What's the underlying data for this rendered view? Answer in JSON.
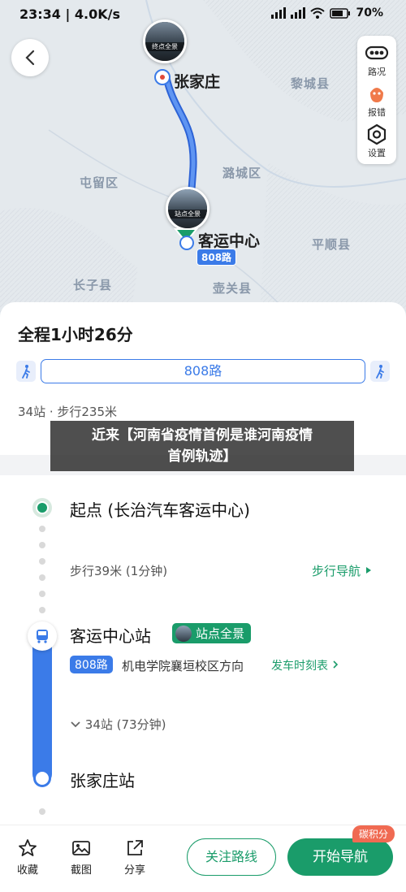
{
  "status": {
    "time": "23:34",
    "speed": "4.0K/s",
    "battery": "70"
  },
  "map": {
    "labels": {
      "shijiazhuang": "张家庄",
      "lichengxian": "黎城县",
      "tunliu": "屯留区",
      "lucheng": "潞城区",
      "keyun": "客运中心",
      "pingshun": "平顺县",
      "zhangzi": "长子县",
      "huguan": "壶关县"
    },
    "end_bubble_label": "终点全景",
    "start_bubble_label": "站点全景",
    "route_badge": "808路",
    "tools": {
      "traffic": "路况",
      "report": "报错",
      "settings": "设置"
    }
  },
  "summary": {
    "title": "全程1小时26分",
    "route_name": "808路",
    "meta": "34站 · 步行235米"
  },
  "caption": {
    "line1": "近来【河南省疫情首例是谁河南疫情",
    "line2": "首例轨迹】"
  },
  "steps": {
    "start": "起点 (长治汽车客运中心)",
    "walk": "步行39米 (1分钟)",
    "walk_nav": "步行导航",
    "station": "客运中心站",
    "station_view": "站点全景",
    "route": "808路",
    "direction": "机电学院襄垣校区方向",
    "timetable": "发车时刻表",
    "stops": "34站 (73分钟)",
    "end_station": "张家庄站"
  },
  "bottom": {
    "collect": "收藏",
    "screenshot": "截图",
    "share": "分享",
    "follow": "关注路线",
    "navigate": "开始导航",
    "carbon": "碳积分"
  },
  "colors": {
    "accent_green": "#1a9c6a",
    "route_blue": "#3b7be8"
  }
}
